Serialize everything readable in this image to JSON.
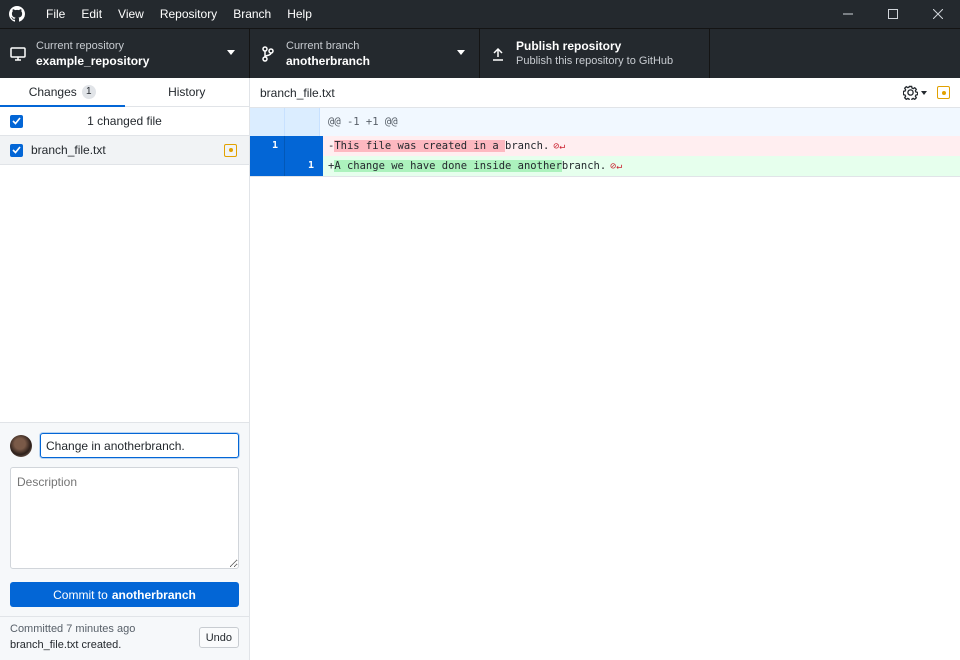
{
  "menu": [
    "File",
    "Edit",
    "View",
    "Repository",
    "Branch",
    "Help"
  ],
  "toolbar": {
    "repo_label": "Current repository",
    "repo_value": "example_repository",
    "branch_label": "Current branch",
    "branch_value": "anotherbranch",
    "publish_title": "Publish repository",
    "publish_subtitle": "Publish this repository to GitHub"
  },
  "sidebar": {
    "tab_changes": "Changes",
    "tab_changes_count": "1",
    "tab_history": "History",
    "changed_files_text": "1 changed file",
    "files": [
      {
        "name": "branch_file.txt",
        "status": "modified",
        "checked": true
      }
    ]
  },
  "commit": {
    "summary_value": "Change in anotherbranch.",
    "description_placeholder": "Description",
    "button_prefix": "Commit to",
    "button_branch": "anotherbranch"
  },
  "last_commit": {
    "meta": "Committed 7 minutes ago",
    "message": "branch_file.txt created.",
    "undo_label": "Undo"
  },
  "diff": {
    "filename": "branch_file.txt",
    "hunk_header": "@@ -1 +1 @@",
    "deleted": {
      "old_line": "1",
      "sign": "-",
      "highlight": "This file was created in a ",
      "rest": "branch."
    },
    "added": {
      "new_line": "1",
      "sign": "+",
      "highlight": "A change we have done inside another",
      "rest": "branch."
    },
    "eol_marker": "⊘↵"
  },
  "colors": {
    "accent": "#0366d6",
    "modified": "#e2a100",
    "titlebar": "#24292e"
  }
}
